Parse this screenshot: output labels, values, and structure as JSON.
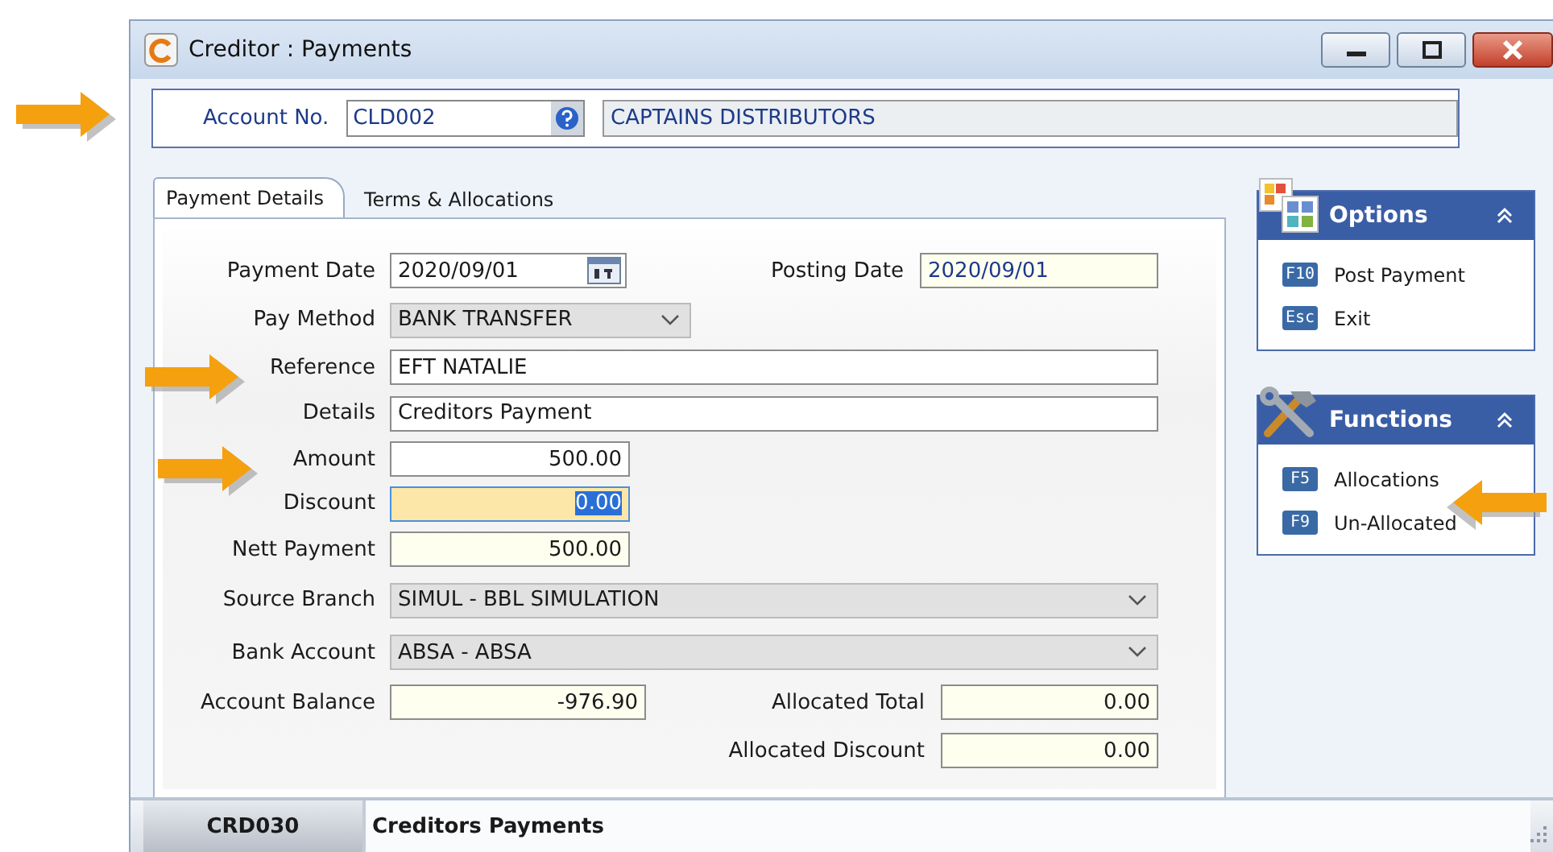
{
  "window": {
    "title": "Creditor : Payments"
  },
  "account": {
    "label": "Account No.",
    "code": "CLD002",
    "name": "CAPTAINS DISTRIBUTORS"
  },
  "tabs": [
    {
      "label": "Payment Details",
      "selected": true
    },
    {
      "label": "Terms &  Allocations",
      "selected": false
    }
  ],
  "form": {
    "payment_date": {
      "label": "Payment Date",
      "value": "2020/09/01"
    },
    "posting_date": {
      "label": "Posting Date",
      "value": "2020/09/01"
    },
    "pay_method": {
      "label": "Pay Method",
      "value": "BANK TRANSFER"
    },
    "reference": {
      "label": "Reference",
      "value": "EFT NATALIE"
    },
    "details": {
      "label": "Details",
      "value": "Creditors Payment"
    },
    "amount": {
      "label": "Amount",
      "value": "500.00"
    },
    "discount": {
      "label": "Discount",
      "value": "0.00",
      "focused": true
    },
    "nett_payment": {
      "label": "Nett Payment",
      "value": "500.00"
    },
    "source_branch": {
      "label": "Source Branch",
      "value": "SIMUL - BBL SIMULATION"
    },
    "bank_account": {
      "label": "Bank Account",
      "value": "ABSA - ABSA"
    },
    "account_balance": {
      "label": "Account Balance",
      "value": "-976.90"
    },
    "allocated_total": {
      "label": "Allocated Total",
      "value": "0.00"
    },
    "allocated_discount": {
      "label": "Allocated Discount",
      "value": "0.00"
    }
  },
  "panels": [
    {
      "kind": "options",
      "title": "Options",
      "expanded": true,
      "items": [
        {
          "key": "F10",
          "label": "Post Payment"
        },
        {
          "key": "Esc",
          "label": "Exit"
        }
      ]
    },
    {
      "kind": "functions",
      "title": "Functions",
      "expanded": true,
      "items": [
        {
          "key": "F5",
          "label": "Allocations"
        },
        {
          "key": "F9",
          "label": "Un-Allocated"
        }
      ]
    }
  ],
  "status_bar": {
    "code": "CRD030",
    "title": "Creditors Payments"
  }
}
